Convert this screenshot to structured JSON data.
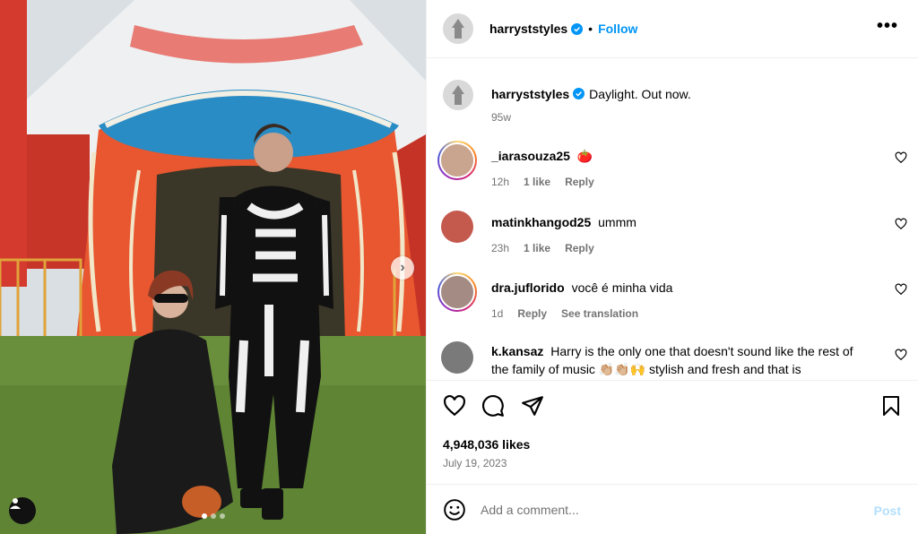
{
  "post": {
    "author": "harryststyles",
    "follow_label": "Follow",
    "separator": "•",
    "more_label": "•••",
    "caption_text": "Daylight. Out now.",
    "caption_time": "95w",
    "likes": "4,948,036 likes",
    "date": "July 19, 2023",
    "media_index": 1,
    "media_count": 3
  },
  "comments": [
    {
      "username": "_iarasouza25",
      "text": "🍅",
      "time": "12h",
      "likes": "1 like",
      "reply": "Reply",
      "extra": ""
    },
    {
      "username": "matinkhangod25",
      "text": "ummm",
      "time": "23h",
      "likes": "1 like",
      "reply": "Reply",
      "extra": ""
    },
    {
      "username": "dra.juflorido",
      "text": "você é minha vida",
      "time": "1d",
      "likes": "",
      "reply": "Reply",
      "extra": "See translation"
    },
    {
      "username": "k.kansaz",
      "text": "Harry is the only one that doesn't sound like the rest of the family of music 👏🏼👏🏼🙌 stylish and fresh and that is",
      "time": "",
      "likes": "",
      "reply": "",
      "extra": ""
    }
  ],
  "composer": {
    "placeholder": "Add a comment...",
    "post_label": "Post"
  },
  "icons": [
    "verified-icon",
    "more-icon",
    "heart-icon",
    "comment-icon",
    "share-icon",
    "bookmark-icon",
    "emoji-icon",
    "user-tag-icon",
    "chevron-right-icon"
  ],
  "colors": {
    "link": "#0095f6",
    "muted": "#737373",
    "post_disabled": "#b2dffc"
  }
}
